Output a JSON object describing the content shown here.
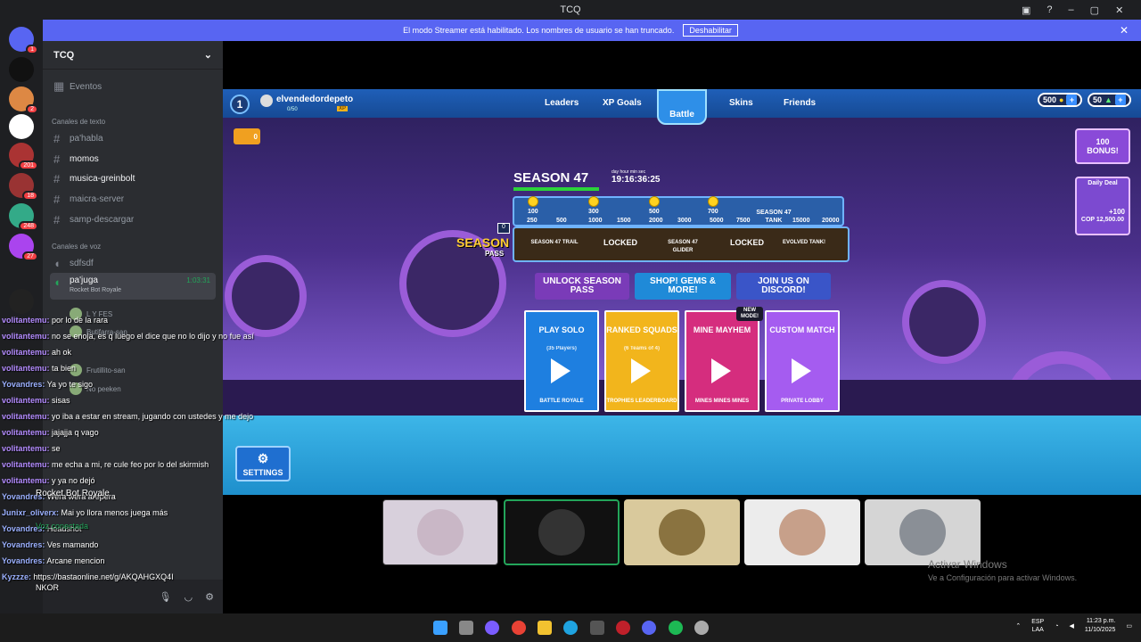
{
  "window": {
    "title": "TCQ"
  },
  "banner": {
    "text": "El modo Streamer está habilitado. Los nombres de usuario se han truncado.",
    "button": "Deshabilitar"
  },
  "servers": [
    {
      "badge": "1"
    },
    {
      "badge": ""
    },
    {
      "badge": "2"
    },
    {
      "badge": ""
    },
    {
      "badge": "201"
    },
    {
      "badge": "18"
    },
    {
      "badge": "248"
    },
    {
      "badge": "27"
    },
    {
      "badge": ""
    }
  ],
  "sidebar": {
    "server_name": "TCQ",
    "events": "Eventos",
    "text_category": "Canales de texto",
    "voice_category": "Canales de voz",
    "text_channels": [
      "pa'habla",
      "momos",
      "musica-greinbolt",
      "maicra-server",
      "samp-descargar"
    ],
    "voice_channels": [
      "sdfsdf",
      "pa'juga"
    ],
    "voice_timer": "1:03:31",
    "voice_status": "Rocket Bot Royale",
    "voice_users": [
      "L Y FES",
      "Butifarra-san",
      "Frutillito-san",
      "No peeken"
    ]
  },
  "chat": [
    {
      "user": "volitantemu:",
      "msg": "por lo de la rara"
    },
    {
      "user": "volitantemu:",
      "msg": "no se enoja, es q luego el dice que no lo dijo y no fue así"
    },
    {
      "user": "volitantemu:",
      "msg": "ah ok"
    },
    {
      "user": "volitantemu:",
      "msg": "ta bien"
    },
    {
      "user": "Yovandres:",
      "msg": "Ya yo te sigo"
    },
    {
      "user": "volitantemu:",
      "msg": "sisas"
    },
    {
      "user": "volitantemu:",
      "msg": "yo iba a estar en stream, jugando con ustedes y me dejo"
    },
    {
      "user": "volitantemu:",
      "msg": "jajajja q vago"
    },
    {
      "user": "volitantemu:",
      "msg": "se"
    },
    {
      "user": "volitantemu:",
      "msg": "me echa a mi, re cule feo por lo del skirmish"
    },
    {
      "user": "volitantemu:",
      "msg": "y ya no dejó"
    },
    {
      "user": "Yovandres:",
      "msg": "Wera wera arepera"
    },
    {
      "user": "Junixr_oliverx:",
      "msg": "Mai yo llora menos juega más"
    },
    {
      "user": "Yovandres:",
      "msg": "Headshot"
    },
    {
      "user": "Yovandres:",
      "msg": "Ves mamando"
    },
    {
      "user": "Yovandres:",
      "msg": "Arcane mencion"
    },
    {
      "user": "Kyzzze:",
      "msg": "https://bastaonline.net/g/AKQAHGXQ4I"
    }
  ],
  "overlay": {
    "activity": "Rocket Bot Royale",
    "voice_connected": "Voz conectada",
    "user": "NKOR"
  },
  "game": {
    "player": {
      "level": "1",
      "name": "elvendedordepeto",
      "xp": "0/50",
      "xp_badge": "XP"
    },
    "nav": [
      "Leaders",
      "XP Goals",
      "Battle",
      "Skins",
      "Friends"
    ],
    "currency": {
      "coins": "500",
      "gems": "50"
    },
    "crates": "0",
    "season": {
      "title": "SEASON 47",
      "timer_labels": "day  hour  min  sec",
      "timer": "19:16:36:25",
      "free_values": [
        "100",
        "300",
        "500",
        "700"
      ],
      "thresholds": [
        "250",
        "500",
        "1000",
        "1500",
        "2000",
        "3000",
        "5000",
        "7500",
        "15000",
        "20000"
      ],
      "premium": [
        "SEASON 47 TRAIL",
        "LOCKED",
        "SEASON 47 GLIDER",
        "LOCKED",
        "EVOLVED TANK!"
      ],
      "top_reward": "SEASON 47 TANK",
      "pass_label": "SEASON",
      "pass_sub": "PASS",
      "zero": "0"
    },
    "promos": [
      {
        "label": "UNLOCK SEASON PASS",
        "color": "#7a3bb8"
      },
      {
        "label": "SHOP! GEMS & MORE!",
        "color": "#1f8ad8"
      },
      {
        "label": "JOIN US ON DISCORD!",
        "color": "#3a55c8"
      }
    ],
    "modes": [
      {
        "title": "PLAY SOLO",
        "sub": "(35 Players)",
        "bottom": "BATTLE ROYALE",
        "color": "#1e7fe0"
      },
      {
        "title": "RANKED SQUADS",
        "sub": "(6 Teams of 4)",
        "bottom": "TROPHIES LEADERBOARD",
        "color": "#f2b51c"
      },
      {
        "title": "MINE MAYHEM",
        "sub": "",
        "bottom": "MINES MINES MINES",
        "color": "#d52d7e",
        "tag": "NEW MODE!"
      },
      {
        "title": "CUSTOM MATCH",
        "sub": "",
        "bottom": "PRIVATE LOBBY",
        "color": "#a55cf0"
      }
    ],
    "settings": "SETTINGS",
    "bonus": {
      "value": "100",
      "label": "BONUS!"
    },
    "daily": {
      "label": "Daily Deal",
      "bonus": "+100",
      "price": "COP 12,500.00"
    }
  },
  "watermark": {
    "line1": "Activar Windows",
    "line2": "Ve a Configuración para activar Windows."
  },
  "tray": {
    "lang1": "ESP",
    "lang2": "LAA",
    "time": "11:23 p.m.",
    "date": "11/10/2025"
  }
}
